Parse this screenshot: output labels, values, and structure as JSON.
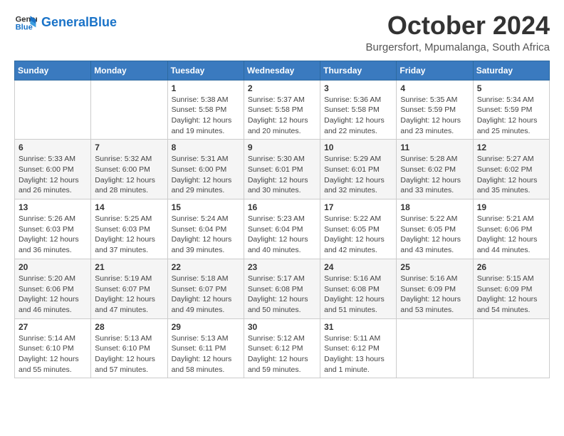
{
  "logo": {
    "text_general": "General",
    "text_blue": "Blue"
  },
  "title": "October 2024",
  "subtitle": "Burgersfort, Mpumalanga, South Africa",
  "weekdays": [
    "Sunday",
    "Monday",
    "Tuesday",
    "Wednesday",
    "Thursday",
    "Friday",
    "Saturday"
  ],
  "weeks": [
    [
      {
        "day": "",
        "info": ""
      },
      {
        "day": "",
        "info": ""
      },
      {
        "day": "1",
        "info": "Sunrise: 5:38 AM\nSunset: 5:58 PM\nDaylight: 12 hours and 19 minutes."
      },
      {
        "day": "2",
        "info": "Sunrise: 5:37 AM\nSunset: 5:58 PM\nDaylight: 12 hours and 20 minutes."
      },
      {
        "day": "3",
        "info": "Sunrise: 5:36 AM\nSunset: 5:58 PM\nDaylight: 12 hours and 22 minutes."
      },
      {
        "day": "4",
        "info": "Sunrise: 5:35 AM\nSunset: 5:59 PM\nDaylight: 12 hours and 23 minutes."
      },
      {
        "day": "5",
        "info": "Sunrise: 5:34 AM\nSunset: 5:59 PM\nDaylight: 12 hours and 25 minutes."
      }
    ],
    [
      {
        "day": "6",
        "info": "Sunrise: 5:33 AM\nSunset: 6:00 PM\nDaylight: 12 hours and 26 minutes."
      },
      {
        "day": "7",
        "info": "Sunrise: 5:32 AM\nSunset: 6:00 PM\nDaylight: 12 hours and 28 minutes."
      },
      {
        "day": "8",
        "info": "Sunrise: 5:31 AM\nSunset: 6:00 PM\nDaylight: 12 hours and 29 minutes."
      },
      {
        "day": "9",
        "info": "Sunrise: 5:30 AM\nSunset: 6:01 PM\nDaylight: 12 hours and 30 minutes."
      },
      {
        "day": "10",
        "info": "Sunrise: 5:29 AM\nSunset: 6:01 PM\nDaylight: 12 hours and 32 minutes."
      },
      {
        "day": "11",
        "info": "Sunrise: 5:28 AM\nSunset: 6:02 PM\nDaylight: 12 hours and 33 minutes."
      },
      {
        "day": "12",
        "info": "Sunrise: 5:27 AM\nSunset: 6:02 PM\nDaylight: 12 hours and 35 minutes."
      }
    ],
    [
      {
        "day": "13",
        "info": "Sunrise: 5:26 AM\nSunset: 6:03 PM\nDaylight: 12 hours and 36 minutes."
      },
      {
        "day": "14",
        "info": "Sunrise: 5:25 AM\nSunset: 6:03 PM\nDaylight: 12 hours and 37 minutes."
      },
      {
        "day": "15",
        "info": "Sunrise: 5:24 AM\nSunset: 6:04 PM\nDaylight: 12 hours and 39 minutes."
      },
      {
        "day": "16",
        "info": "Sunrise: 5:23 AM\nSunset: 6:04 PM\nDaylight: 12 hours and 40 minutes."
      },
      {
        "day": "17",
        "info": "Sunrise: 5:22 AM\nSunset: 6:05 PM\nDaylight: 12 hours and 42 minutes."
      },
      {
        "day": "18",
        "info": "Sunrise: 5:22 AM\nSunset: 6:05 PM\nDaylight: 12 hours and 43 minutes."
      },
      {
        "day": "19",
        "info": "Sunrise: 5:21 AM\nSunset: 6:06 PM\nDaylight: 12 hours and 44 minutes."
      }
    ],
    [
      {
        "day": "20",
        "info": "Sunrise: 5:20 AM\nSunset: 6:06 PM\nDaylight: 12 hours and 46 minutes."
      },
      {
        "day": "21",
        "info": "Sunrise: 5:19 AM\nSunset: 6:07 PM\nDaylight: 12 hours and 47 minutes."
      },
      {
        "day": "22",
        "info": "Sunrise: 5:18 AM\nSunset: 6:07 PM\nDaylight: 12 hours and 49 minutes."
      },
      {
        "day": "23",
        "info": "Sunrise: 5:17 AM\nSunset: 6:08 PM\nDaylight: 12 hours and 50 minutes."
      },
      {
        "day": "24",
        "info": "Sunrise: 5:16 AM\nSunset: 6:08 PM\nDaylight: 12 hours and 51 minutes."
      },
      {
        "day": "25",
        "info": "Sunrise: 5:16 AM\nSunset: 6:09 PM\nDaylight: 12 hours and 53 minutes."
      },
      {
        "day": "26",
        "info": "Sunrise: 5:15 AM\nSunset: 6:09 PM\nDaylight: 12 hours and 54 minutes."
      }
    ],
    [
      {
        "day": "27",
        "info": "Sunrise: 5:14 AM\nSunset: 6:10 PM\nDaylight: 12 hours and 55 minutes."
      },
      {
        "day": "28",
        "info": "Sunrise: 5:13 AM\nSunset: 6:10 PM\nDaylight: 12 hours and 57 minutes."
      },
      {
        "day": "29",
        "info": "Sunrise: 5:13 AM\nSunset: 6:11 PM\nDaylight: 12 hours and 58 minutes."
      },
      {
        "day": "30",
        "info": "Sunrise: 5:12 AM\nSunset: 6:12 PM\nDaylight: 12 hours and 59 minutes."
      },
      {
        "day": "31",
        "info": "Sunrise: 5:11 AM\nSunset: 6:12 PM\nDaylight: 13 hours and 1 minute."
      },
      {
        "day": "",
        "info": ""
      },
      {
        "day": "",
        "info": ""
      }
    ]
  ]
}
